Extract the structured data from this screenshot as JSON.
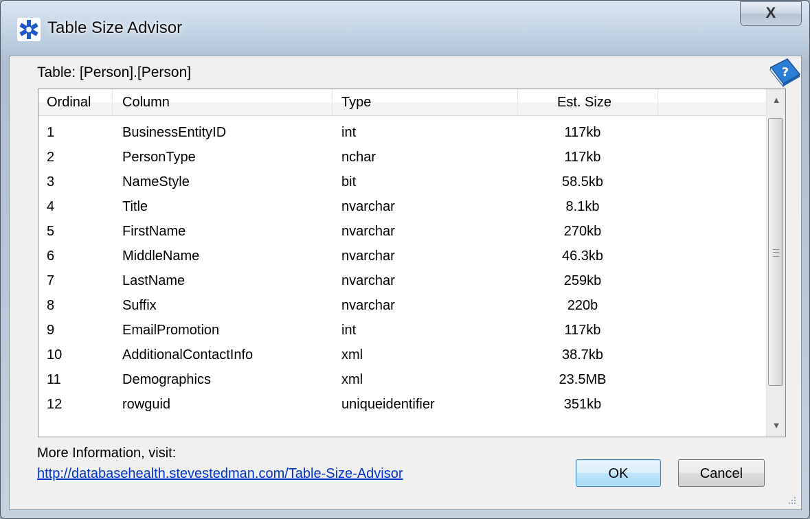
{
  "window": {
    "title": "Table Size Advisor",
    "close_label": "X"
  },
  "table_label": "Table: [Person].[Person]",
  "list": {
    "columns": [
      "Ordinal",
      "Column",
      "Type",
      "Est. Size"
    ],
    "rows": [
      {
        "ordinal": "1",
        "column": "BusinessEntityID",
        "type": "int",
        "size": "117kb"
      },
      {
        "ordinal": "2",
        "column": "PersonType",
        "type": "nchar",
        "size": "117kb"
      },
      {
        "ordinal": "3",
        "column": "NameStyle",
        "type": "bit",
        "size": "58.5kb"
      },
      {
        "ordinal": "4",
        "column": "Title",
        "type": "nvarchar",
        "size": "8.1kb"
      },
      {
        "ordinal": "5",
        "column": "FirstName",
        "type": "nvarchar",
        "size": "270kb"
      },
      {
        "ordinal": "6",
        "column": "MiddleName",
        "type": "nvarchar",
        "size": "46.3kb"
      },
      {
        "ordinal": "7",
        "column": "LastName",
        "type": "nvarchar",
        "size": "259kb"
      },
      {
        "ordinal": "8",
        "column": "Suffix",
        "type": "nvarchar",
        "size": "220b"
      },
      {
        "ordinal": "9",
        "column": "EmailPromotion",
        "type": "int",
        "size": "117kb"
      },
      {
        "ordinal": "10",
        "column": "AdditionalContactInfo",
        "type": "xml",
        "size": "38.7kb"
      },
      {
        "ordinal": "11",
        "column": "Demographics",
        "type": "xml",
        "size": "23.5MB"
      },
      {
        "ordinal": "12",
        "column": "rowguid",
        "type": "uniqueidentifier",
        "size": "351kb"
      }
    ],
    "scroll_fraction": 0.0
  },
  "footer": {
    "more_info": "More Information, visit:",
    "link": "http://databasehealth.stevestedman.com/Table-Size-Advisor",
    "ok_label": "OK",
    "cancel_label": "Cancel"
  },
  "icons": {
    "app": "asterisk-app-icon",
    "help": "help-book-icon",
    "close": "close-icon"
  },
  "colors": {
    "link": "#0033cc",
    "ok_border": "#3c7fb1"
  }
}
